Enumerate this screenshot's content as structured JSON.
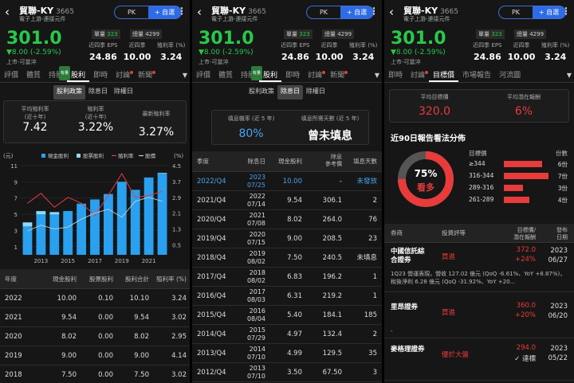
{
  "stock": {
    "name": "貿聯-KY",
    "code": "3665",
    "industry": "電子上游-連接元件",
    "price": "301.0",
    "change": "▼8.00 (-2.59%)",
    "market": "上市-可當沖",
    "vol_label": "單量",
    "vol_value": "323",
    "vol2": "總量 4299",
    "pk": "PK",
    "add": "+ 自選",
    "back": "‹",
    "more": "⋮"
  },
  "kpis": [
    {
      "label": "近四季 EPS",
      "value": "24.86"
    },
    {
      "label": "近四季",
      "value": "10.00"
    },
    {
      "label": "殖利率 (%)",
      "value": "3.24"
    }
  ],
  "tabs1": [
    "評價",
    "體質",
    "持股",
    "股利",
    "即時",
    "討論",
    "新聞"
  ],
  "tabs3": [
    "即時",
    "討論",
    "目標價",
    "市場報告",
    "河流圖"
  ],
  "tab_badge": "有量",
  "div": {
    "subtabs": [
      "股利政策",
      "除息日",
      "除權日"
    ],
    "stats": [
      {
        "label": "平均殖利率\n(近十年)",
        "value": "7.42"
      },
      {
        "label": "殖利率\n(近十年)",
        "value": "3.22%"
      },
      {
        "label": "最新殖利率",
        "value": "3.27%"
      }
    ],
    "legend": [
      "現金股利",
      "股票股利",
      "殖利率",
      "股價"
    ],
    "yl_unit": "(元)",
    "yr_unit": "(%)",
    "headers": [
      "年度",
      "現金股利",
      "股票股利",
      "股利合計",
      "殖利率 (%)"
    ],
    "rows": [
      [
        "2022",
        "10.00",
        "0.10",
        "10.10",
        "3.24"
      ],
      [
        "2021",
        "9.54",
        "0.00",
        "9.54",
        "3.02"
      ],
      [
        "2020",
        "8.02",
        "0.00",
        "8.02",
        "2.95"
      ],
      [
        "2019",
        "9.00",
        "0.00",
        "9.00",
        "4.14"
      ],
      [
        "2018",
        "7.50",
        "0.00",
        "7.50",
        "3.02"
      ]
    ]
  },
  "chart_data": {
    "type": "bar",
    "categories": [
      "2012",
      "2013",
      "2014",
      "2015",
      "2016",
      "2017",
      "2018",
      "2019",
      "2020",
      "2021",
      "2022"
    ],
    "series": [
      {
        "name": "現金股利",
        "values": [
          3.5,
          4.99,
          4.97,
          5.4,
          6.31,
          6.83,
          7.5,
          9.0,
          8.02,
          9.54,
          10.0
        ]
      },
      {
        "name": "股票股利",
        "values": [
          0.5,
          0.4,
          0.3,
          0,
          0,
          0,
          0,
          0,
          0,
          0,
          0.1
        ]
      },
      {
        "name": "殖利率",
        "values": [
          2.6,
          3.1,
          2.4,
          2.9,
          2.6,
          2.0,
          3.0,
          4.1,
          2.9,
          3.0,
          3.2
        ]
      },
      {
        "name": "股價",
        "values": [
          1.2,
          1.5,
          1.3,
          1.4,
          1.8,
          2.1,
          2.3,
          1.9,
          2.7,
          2.9,
          2.7
        ]
      }
    ],
    "x_ticks": [
      "2013",
      "2015",
      "2017",
      "2019",
      "2021"
    ],
    "y_left_ticks": [
      "11",
      "9",
      "7",
      "5",
      "3",
      "1"
    ],
    "y_right_ticks": [
      "4.5",
      "3.7",
      "2.9",
      "2.1",
      "1.3",
      "0.5"
    ],
    "ylim_left": [
      0,
      11
    ],
    "ylim_right": [
      0,
      4.5
    ]
  },
  "exdiv": {
    "subtabs": [
      "股利政策",
      "除息日",
      "除權日"
    ],
    "stats": [
      {
        "label": "填息機率 (近 5 年)",
        "value": "80%"
      },
      {
        "label": "填息所需天數 (近 5 年)",
        "value": "曾未填息"
      }
    ],
    "headers": [
      "季度",
      "除息日",
      "現金股利",
      "除息\n參考價",
      "填息天數"
    ],
    "rows": [
      [
        "2022/Q4",
        "2023\n07/25",
        "10.00",
        "-",
        "未發放"
      ],
      [
        "2021/Q4",
        "2022\n07/14",
        "9.54",
        "306.1",
        "2"
      ],
      [
        "2020/Q4",
        "2021\n07/08",
        "8.02",
        "264.0",
        "76"
      ],
      [
        "2019/Q4",
        "2020\n07/15",
        "9.00",
        "208.5",
        "23"
      ],
      [
        "2018/Q4",
        "2019\n08/02",
        "7.50",
        "240.5",
        "未填息"
      ],
      [
        "2017/Q4",
        "2018\n08/02",
        "6.83",
        "196.2",
        "1"
      ],
      [
        "2016/Q4",
        "2017\n08/03",
        "6.31",
        "219.2",
        "1"
      ],
      [
        "2015/Q4",
        "2016\n08/04",
        "5.40",
        "184.1",
        "185"
      ],
      [
        "2014/Q4",
        "2015\n07/29",
        "4.97",
        "132.4",
        "2"
      ],
      [
        "2013/Q4",
        "2014\n07/10",
        "4.99",
        "129.5",
        "35"
      ],
      [
        "2012/Q4",
        "2013\n07/10",
        "3.50",
        "67.50",
        "3"
      ]
    ]
  },
  "target": {
    "stats": [
      {
        "label": "平均目標價",
        "value": "320.0"
      },
      {
        "label": "平均潛在報酬",
        "value": "6%"
      }
    ],
    "dist_title": "近90日報告看法分佈",
    "donut_pct": "75%",
    "donut_label": "看多",
    "donut_value": 0.75,
    "dist_headers": [
      "目標價",
      "份數"
    ],
    "dist": [
      {
        "range": "≥344",
        "count": "6份",
        "frac": 0.86
      },
      {
        "range": "316-344",
        "count": "7份",
        "frac": 1.0
      },
      {
        "range": "289-316",
        "count": "3份",
        "frac": 0.43
      },
      {
        "range": "261-289",
        "count": "4份",
        "frac": 0.57
      }
    ],
    "headers": [
      "券商",
      "投資評等",
      "目標價/\n潛在報酬",
      "發布\n日期"
    ],
    "reports": [
      {
        "broker": "中國信託綜\n合證券",
        "rating": "買進",
        "target": "372.0",
        "ret": "+24%",
        "date": "2023\n06/27",
        "note": "1Q23 營運表現，營收 127.02 億元 (QoQ -6.61%、YoY +8.87%)，稅後淨利 6.28 億元 (QoQ -31.92%、YoY +20..."
      },
      {
        "broker": "里昂證券",
        "rating": "買進",
        "target": "360.0",
        "ret": "+20%",
        "date": "2023\n06/20",
        "note": "-"
      },
      {
        "broker": "麥格理證券",
        "rating": "優於大盤",
        "target": "294.0",
        "ret": "✓ 達標",
        "date": "2023\n05/22",
        "note": ""
      }
    ]
  }
}
